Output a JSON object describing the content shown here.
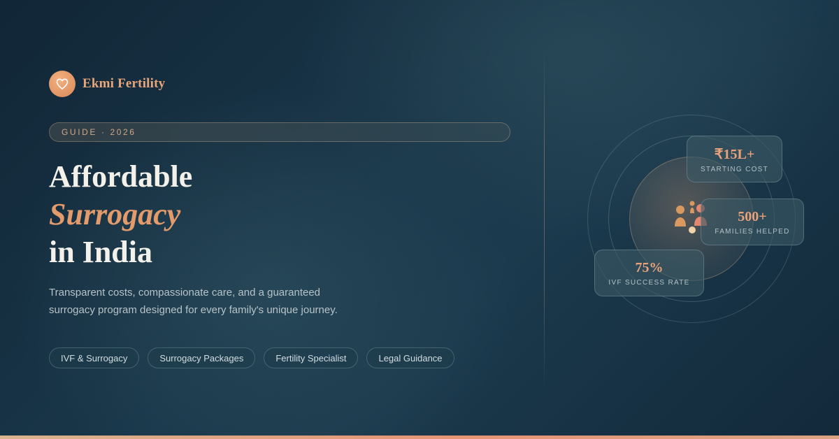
{
  "brand": {
    "name": "Ekmi Fertility",
    "logo_icon": "heart-icon",
    "logo_color": "#e39b6c"
  },
  "guide": {
    "label": "GUIDE · 2026"
  },
  "headline": {
    "line1": "Affordable",
    "line2": "Surrogacy",
    "line3": "in India",
    "accent_color": "#e39b6c"
  },
  "subtitle": "Transparent costs, compassionate care, and a guaranteed surrogacy program designed for every family's unique journey.",
  "tags": [
    {
      "label": "IVF & Surrogacy"
    },
    {
      "label": "Surrogacy Packages"
    },
    {
      "label": "Fertility Specialist"
    },
    {
      "label": "Legal Guidance"
    }
  ],
  "stats": {
    "cost": {
      "value": "₹15L+",
      "label": "STARTING COST"
    },
    "families": {
      "value": "500+",
      "label": "FAMILIES HELPED"
    },
    "ivf": {
      "value": "75%",
      "label": "IVF SUCCESS RATE"
    }
  },
  "center_icon": "family-icon"
}
